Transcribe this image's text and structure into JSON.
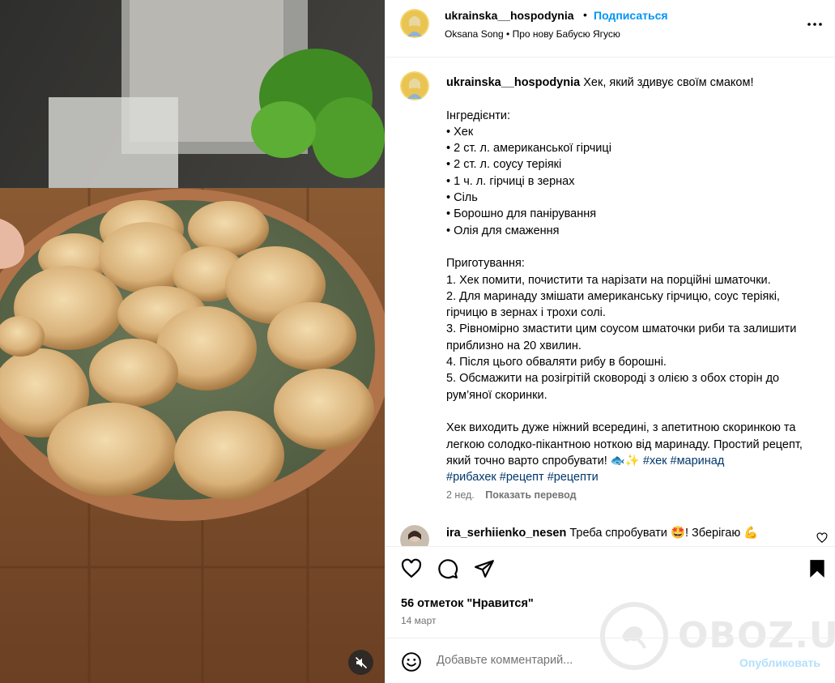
{
  "post": {
    "username": "ukrainska__hospodynia",
    "follow_label": "Подписаться",
    "audio": "Oksana Song • Про нову Бабусю Ягусю",
    "more_icon": "more-horizontal-icon"
  },
  "caption": {
    "username": "ukrainska__hospodynia",
    "body": "Хек, який здивує своїм смаком!\n\nІнгредієнти:\n• Хек\n• 2 ст. л. американської гірчиці\n• 2 ст. л. соусу теріякі\n• 1 ч. л. гірчиці в зернах\n• Сіль\n• Борошно для панірування\n• Олія для смаження\n\nПриготування:\n1. Хек помити, почистити та нарізати на порційні шматочки.\n2. Для маринаду змішати американську гірчицю, соус теріякі, гірчицю в зернах і трохи солі.\n3. Рівномірно змастити цим соусом шматочки риби та залишити приблизно на 20 хвилин.\n4. Після цього обваляти рибу в борошні.\n5. Обсмажити на розігрітій сковороді з олією з обох сторін до рум’яної скоринки.\n\nХек виходить дуже ніжний всередині, з апетитною скоринкою та легкою солодко-пікантною ноткою від маринаду. Простий рецепт, який точно варто спробувати! 🐟✨ ",
    "hashtags_inline": "#хек #маринад",
    "hashtags_line2": "#рибахек #рецепт #рецепти",
    "age": "2 нед.",
    "translate_label": "Показать перевод"
  },
  "comment": {
    "username": "ira_serhiienko_nesen",
    "text": "Треба спробувати 🤩! Зберігаю 💪"
  },
  "actions": {
    "like_icon": "heart-icon",
    "comment_icon": "comment-icon",
    "share_icon": "share-icon",
    "save_icon": "bookmark-icon",
    "likes": "56 отметок \"Нравится\"",
    "date": "14 март"
  },
  "watermark": {
    "text": "OBOZ.UA"
  },
  "comment_box": {
    "placeholder": "Добавьте комментарий...",
    "publish_label": "Опубликовать",
    "emoji_icon": "emoji-icon"
  },
  "colors": {
    "link_blue": "#0095f6",
    "hashtag": "#00376b",
    "muted": "#737373",
    "publish_disabled": "#b2dffc",
    "border": "#efefef"
  },
  "video": {
    "mute_icon": "volume-muted-icon"
  }
}
